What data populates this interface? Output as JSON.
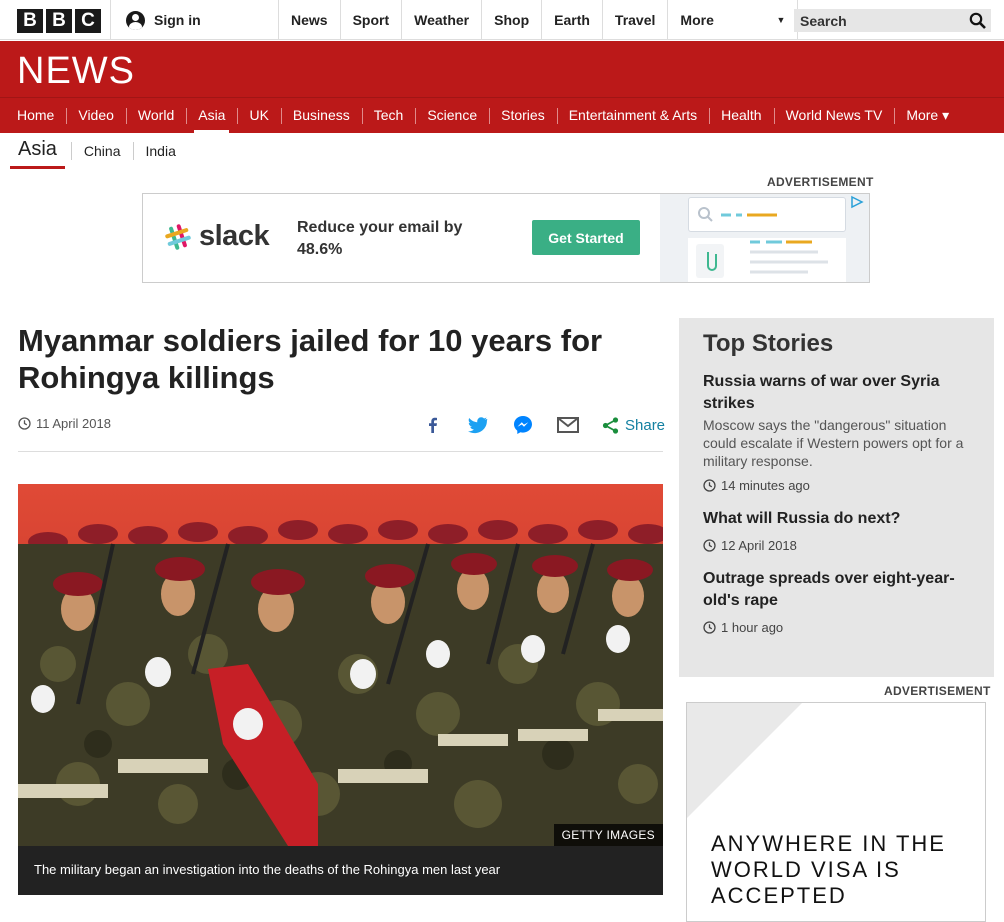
{
  "topbar": {
    "logo_letters": [
      "B",
      "B",
      "C"
    ],
    "signin_label": "Sign in",
    "nav": [
      "News",
      "Sport",
      "Weather",
      "Shop",
      "Earth",
      "Travel"
    ],
    "more_label": "More",
    "search_placeholder": "Search"
  },
  "masthead": {
    "title": "NEWS",
    "nav": [
      {
        "label": "Home",
        "active": false
      },
      {
        "label": "Video",
        "active": false
      },
      {
        "label": "World",
        "active": false
      },
      {
        "label": "Asia",
        "active": true
      },
      {
        "label": "UK",
        "active": false
      },
      {
        "label": "Business",
        "active": false
      },
      {
        "label": "Tech",
        "active": false
      },
      {
        "label": "Science",
        "active": false
      },
      {
        "label": "Stories",
        "active": false
      },
      {
        "label": "Entertainment & Arts",
        "active": false
      },
      {
        "label": "Health",
        "active": false
      },
      {
        "label": "World News TV",
        "active": false
      },
      {
        "label": "More ▾",
        "active": false
      }
    ]
  },
  "subnav": {
    "current": "Asia",
    "items": [
      "China",
      "India"
    ]
  },
  "advert_label": "ADVERTISEMENT",
  "banner_ad": {
    "brand": "slack",
    "promo": "Reduce your email by 48.6%",
    "cta": "Get Started"
  },
  "article": {
    "headline": "Myanmar soldiers jailed for 10 years for Rohingya killings",
    "date": "11 April 2018",
    "share_label": "Share",
    "share_icons": [
      "facebook-icon",
      "twitter-icon",
      "messenger-icon",
      "email-icon",
      "share-icon"
    ],
    "image_credit": "GETTY IMAGES",
    "image_caption": "The military began an investigation into the deaths of the Rohingya men last year"
  },
  "top_stories": {
    "title": "Top Stories",
    "stories": [
      {
        "headline": "Russia warns of war over Syria strikes",
        "summary": "Moscow says the \"dangerous\" situation could escalate if Western powers opt for a military response.",
        "time": "14 minutes ago"
      },
      {
        "headline": "What will Russia do next?",
        "summary": "",
        "time": "12 April 2018"
      },
      {
        "headline": "Outrage spreads over eight-year-old's rape",
        "summary": "",
        "time": "1 hour ago"
      }
    ]
  },
  "sky_ad": {
    "text": "ANYWHERE IN THE WORLD VISA IS ACCEPTED"
  },
  "colors": {
    "bbc_red": "#bb1919",
    "slack_cta": "#3aaf85",
    "share_blue": "#1380a1"
  }
}
